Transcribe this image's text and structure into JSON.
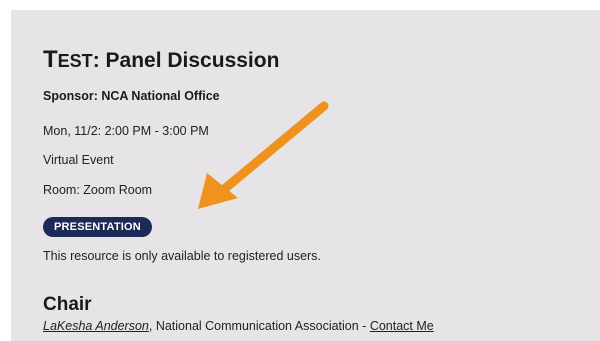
{
  "event": {
    "title_prefix_first": "T",
    "title_prefix_rest": "est",
    "title_rest": ": Panel Discussion",
    "sponsor": "Sponsor: NCA National Office",
    "datetime": "Mon, 11/2: 2:00 PM  - 3:00 PM",
    "location": "Virtual Event",
    "room": "Room: Zoom Room",
    "badge": "PRESENTATION",
    "access_note": "This resource is only available to registered users."
  },
  "chair": {
    "heading": "Chair",
    "name": "LaKesha Anderson",
    "affiliation": ", National Communication Association  - ",
    "contact": "Contact Me"
  },
  "colors": {
    "card_bg": "#e7e4e8",
    "badge_bg": "#1c2a56",
    "arrow": "#f0921e"
  }
}
